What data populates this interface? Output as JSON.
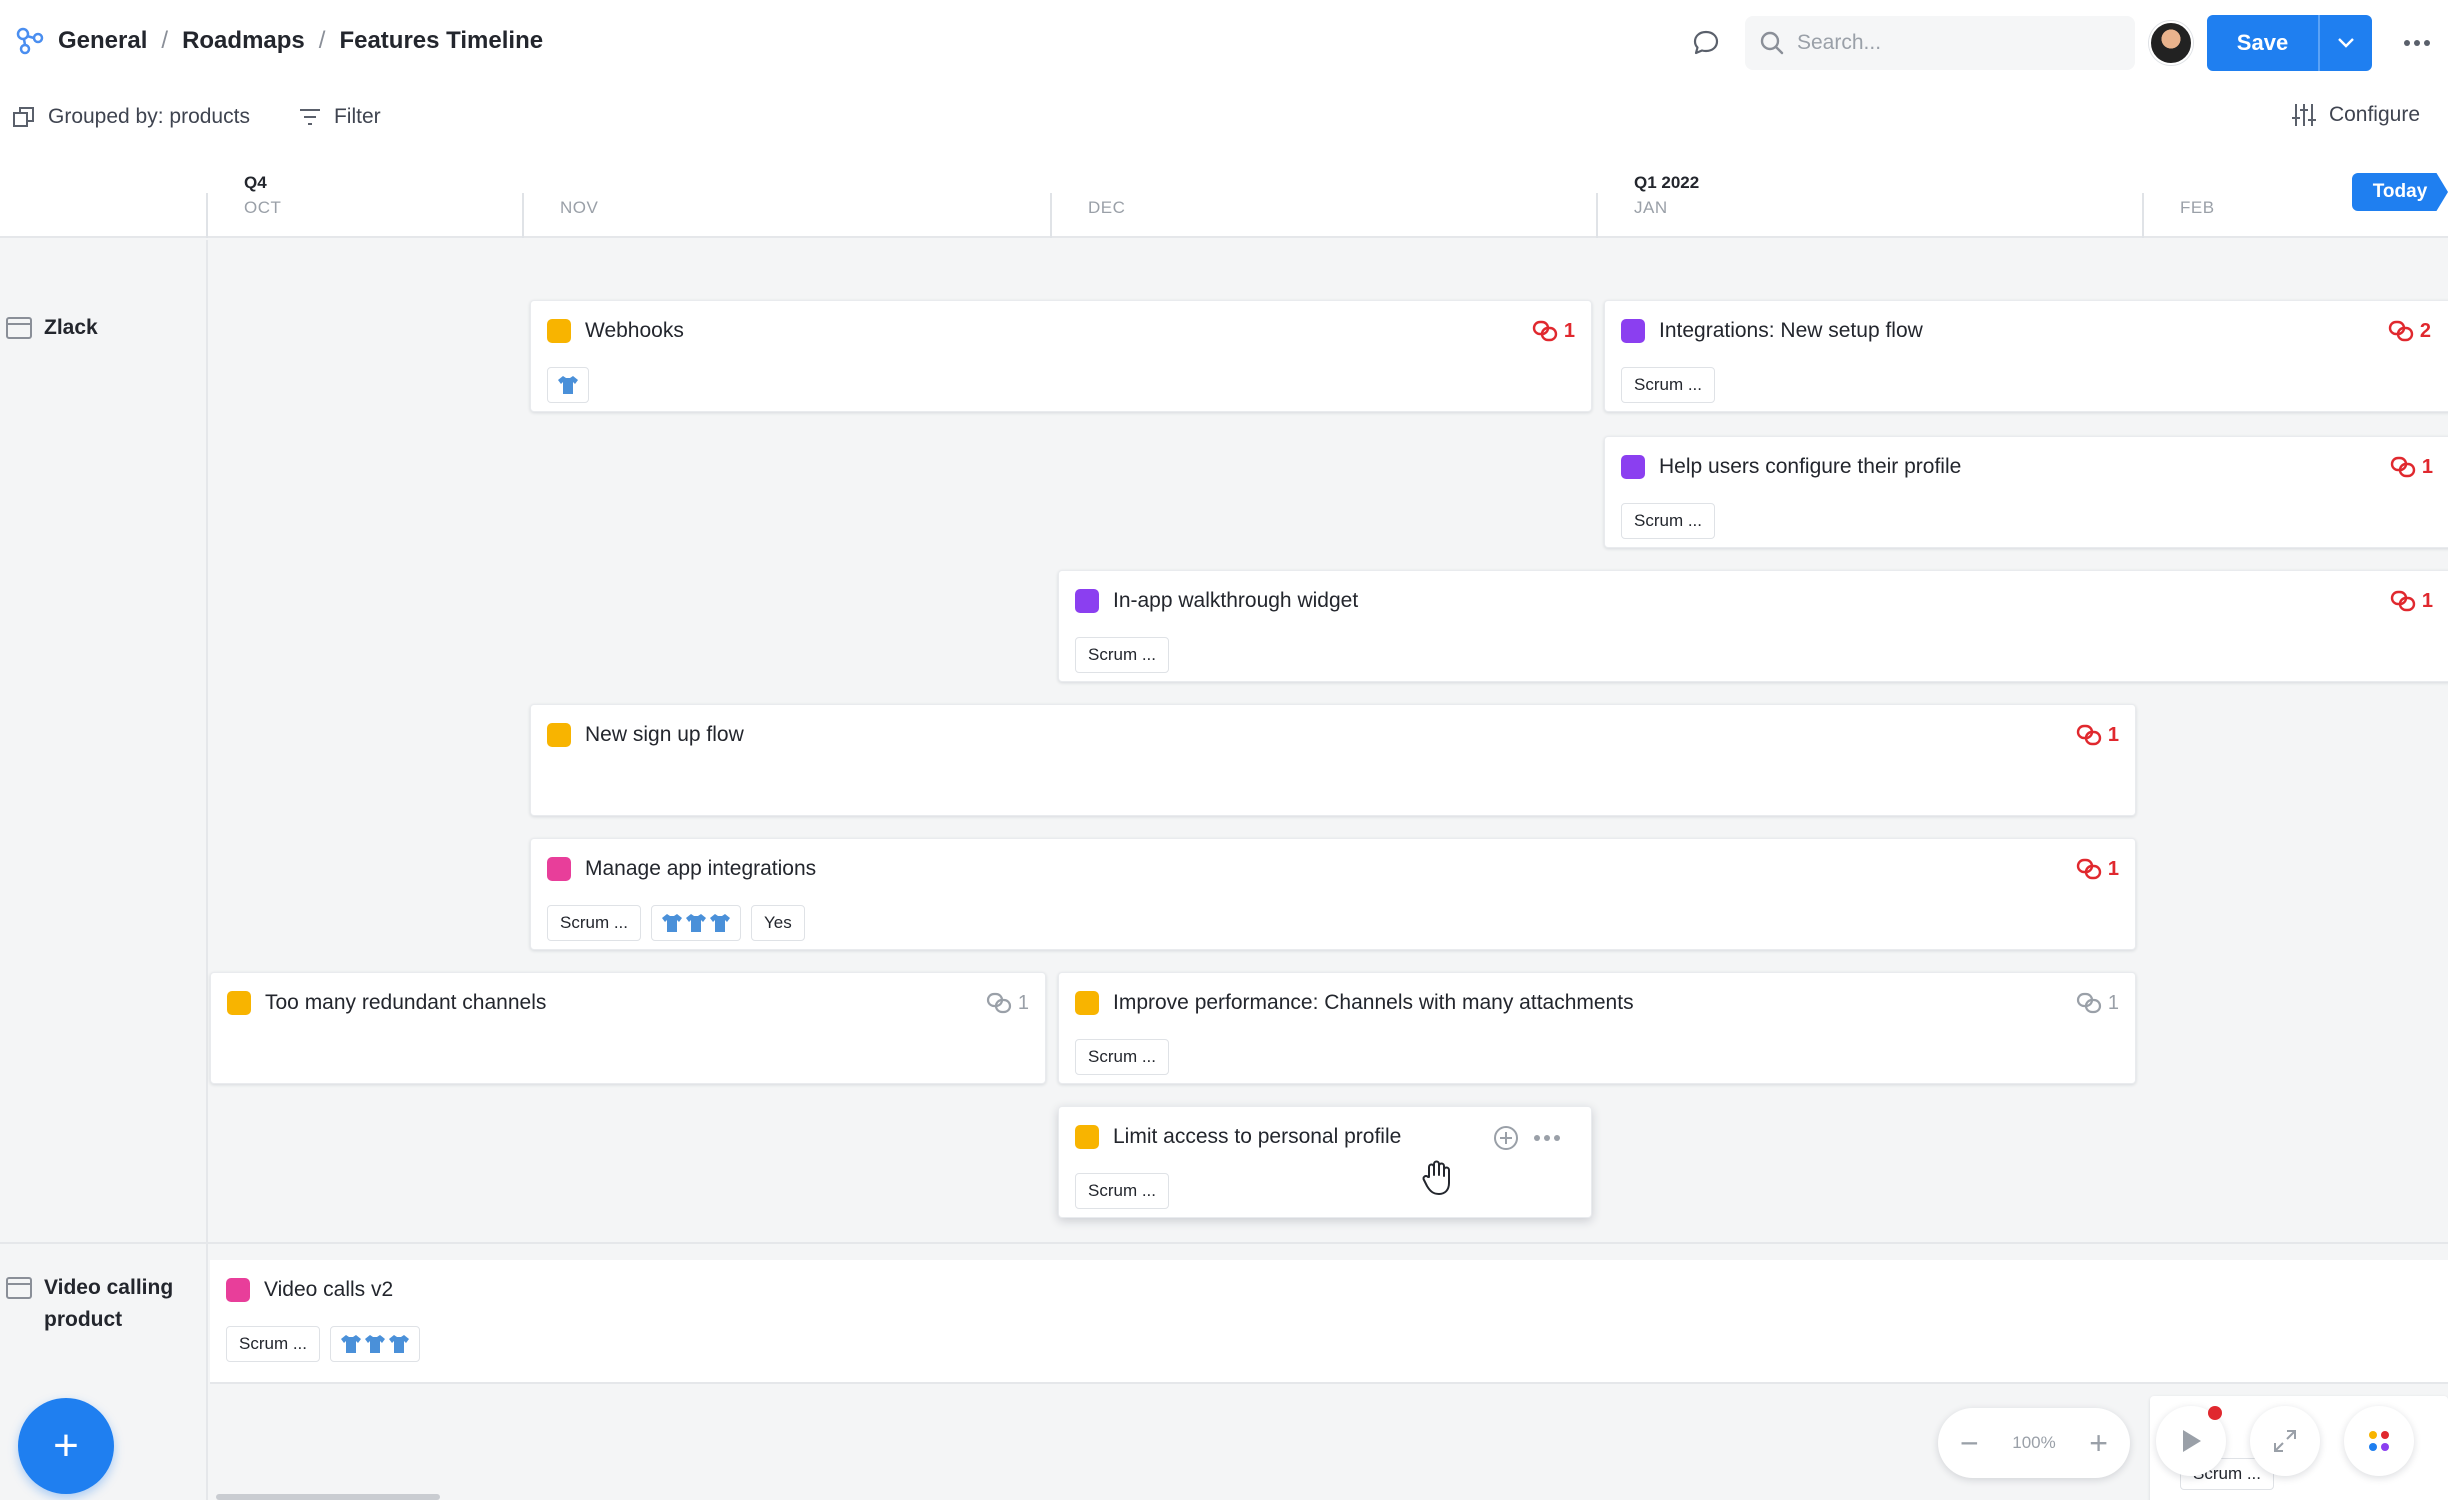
{
  "breadcrumb": {
    "items": [
      "General",
      "Roadmaps",
      "Features Timeline"
    ],
    "separator": "/"
  },
  "header": {
    "search_placeholder": "Search...",
    "save_label": "Save"
  },
  "toolbar": {
    "grouped_by": "Grouped by: products",
    "filter": "Filter",
    "configure": "Configure"
  },
  "timeline": {
    "quarters": [
      "Q4",
      "Q1 2022"
    ],
    "months": [
      "OCT",
      "NOV",
      "DEC",
      "JAN",
      "FEB"
    ],
    "today_label": "Today"
  },
  "groups": [
    {
      "label": "Zlack"
    },
    {
      "label": "Video calling product"
    }
  ],
  "colors": {
    "accent": "#1f7ff0",
    "yellow": "#f8b400",
    "purple": "#8b3ff0",
    "pink": "#e83e9a",
    "link_red": "#e0282e"
  },
  "cards": [
    {
      "title": "Webhooks",
      "color": "yellow",
      "link_count": "1",
      "tags": [],
      "team_icons": "shirt-icon"
    },
    {
      "title": "Integrations: New setup flow",
      "color": "purple",
      "link_count": "2",
      "tags": [
        "Scrum ..."
      ]
    },
    {
      "title": "Help users configure their profile",
      "color": "purple",
      "link_count": "1",
      "tags": [
        "Scrum ..."
      ]
    },
    {
      "title": "In-app walkthrough widget",
      "color": "purple",
      "link_count": "1",
      "tags": [
        "Scrum ..."
      ]
    },
    {
      "title": "New sign up flow",
      "color": "yellow",
      "link_count": "1",
      "tags": []
    },
    {
      "title": "Manage app integrations",
      "color": "pink",
      "link_count": "1",
      "tags": [
        "Scrum ...",
        "Yes"
      ]
    },
    {
      "title": "Too many redundant channels",
      "color": "yellow",
      "link_count": "1",
      "tags": []
    },
    {
      "title": "Improve performance: Channels with many attachments",
      "color": "yellow",
      "link_count": "1",
      "tags": [
        "Scrum ..."
      ]
    },
    {
      "title": "Limit access to personal profile",
      "color": "yellow",
      "tags": [
        "Scrum ..."
      ]
    },
    {
      "title": "Video calls v2",
      "color": "pink",
      "tags": [
        "Scrum ..."
      ]
    }
  ],
  "partial_card": {
    "tag": "Scrum ..."
  },
  "zoom": {
    "level": "100%",
    "minus": "−",
    "plus": "+"
  },
  "fab": {
    "label": "+"
  }
}
